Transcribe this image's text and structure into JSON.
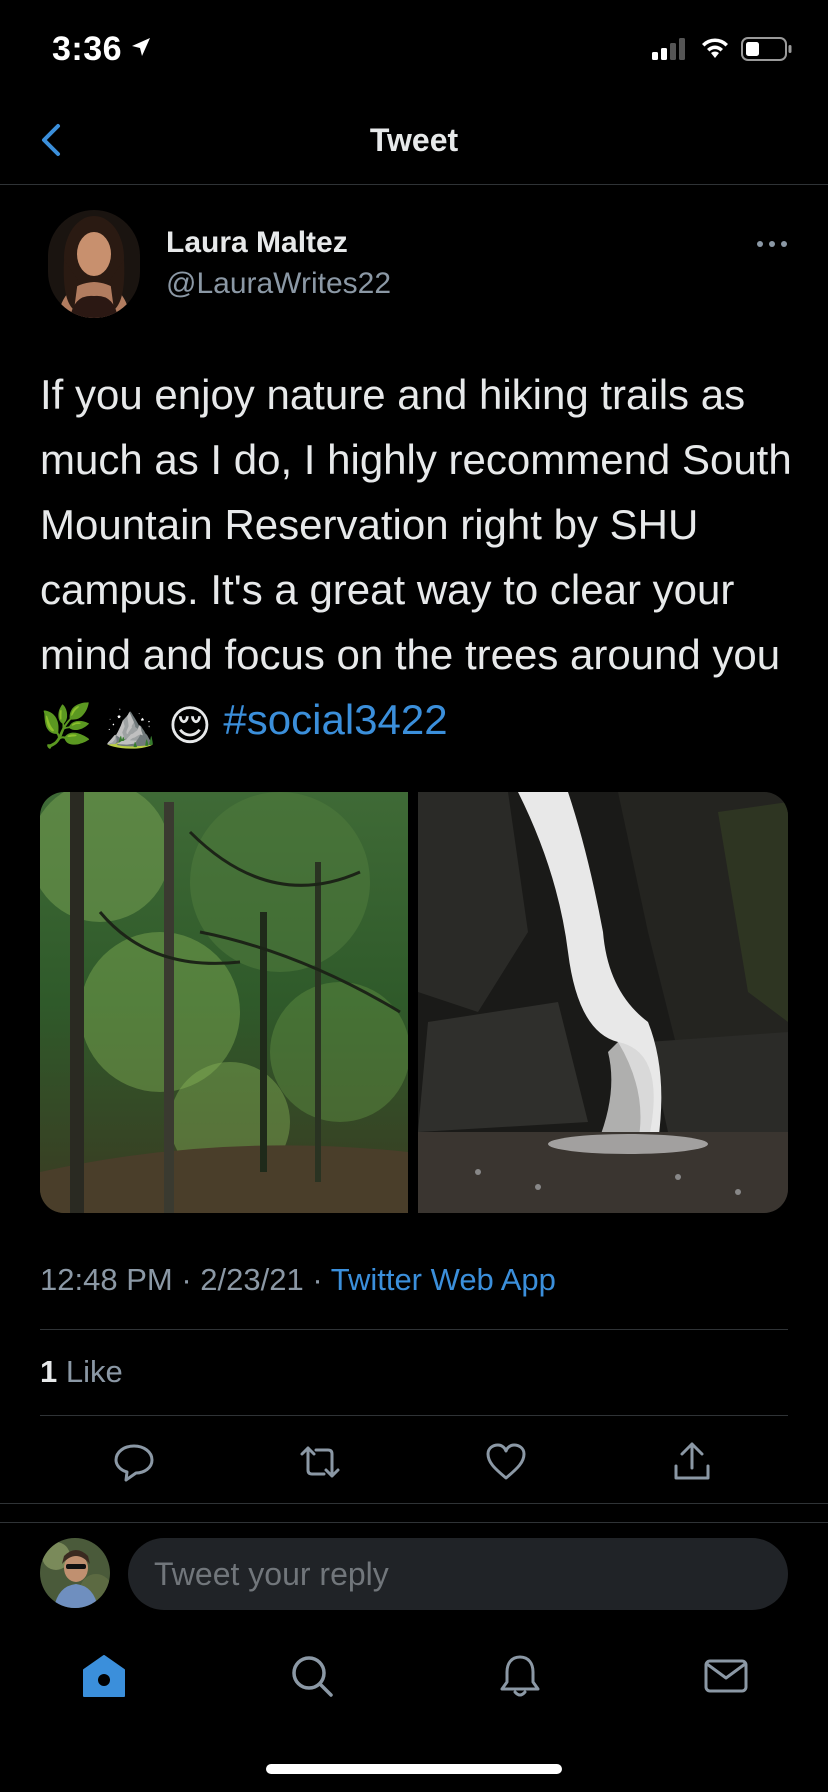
{
  "status_bar": {
    "time": "3:36"
  },
  "header": {
    "title": "Tweet"
  },
  "tweet": {
    "author_name": "Laura Maltez",
    "author_handle": "@LauraWrites22",
    "text": "If you enjoy nature and hiking trails as much as I do, I highly recommend South Mountain Reservation right by SHU campus. It's a great way to clear your mind and focus on the trees around you",
    "emojis": [
      "🌿",
      "⛰️",
      "😌"
    ],
    "hashtag": "#social3422",
    "time": "12:48 PM",
    "date": "2/23/21",
    "source": "Twitter Web App",
    "like_count": "1",
    "like_label": "Like"
  },
  "reply": {
    "placeholder": "Tweet your reply"
  },
  "colors": {
    "accent": "#3b8fdb",
    "background": "#000000",
    "secondary_text": "#8b98a5"
  },
  "icons": {
    "back": "chevron-left-icon",
    "more": "more-horizontal-icon",
    "reply": "reply-icon",
    "retweet": "retweet-icon",
    "like": "heart-icon",
    "share": "share-icon",
    "home": "home-icon",
    "search": "search-icon",
    "notifications": "bell-icon",
    "messages": "mail-icon"
  }
}
